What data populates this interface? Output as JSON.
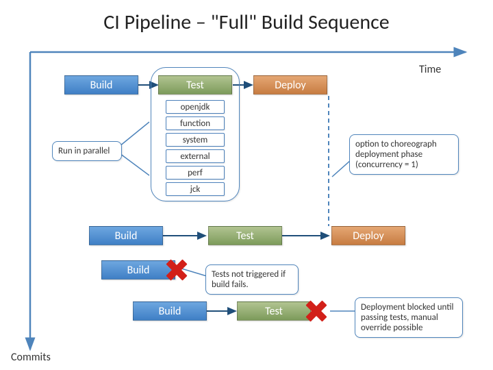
{
  "title": "CI Pipeline – \"Full\" Build Sequence",
  "axes": {
    "time": "Time",
    "commits": "Commits"
  },
  "stages": {
    "build": "Build",
    "test": "Test",
    "deploy": "Deploy"
  },
  "test_subitems": [
    "openjdk",
    "function",
    "system",
    "external",
    "perf",
    "jck"
  ],
  "callouts": {
    "run_parallel": "Run in parallel",
    "choreograph": "option to choreograph deployment phase (concurrency = 1)",
    "tests_not_triggered": "Tests not triggered if build fails.",
    "deploy_blocked": "Deployment blocked until passing tests, manual override possible"
  },
  "colors": {
    "axis": "#4e84bb",
    "arrow_dark": "#1f4e79",
    "build": "#4f87c9",
    "test": "#8aa968",
    "deploy": "#d08a53"
  }
}
